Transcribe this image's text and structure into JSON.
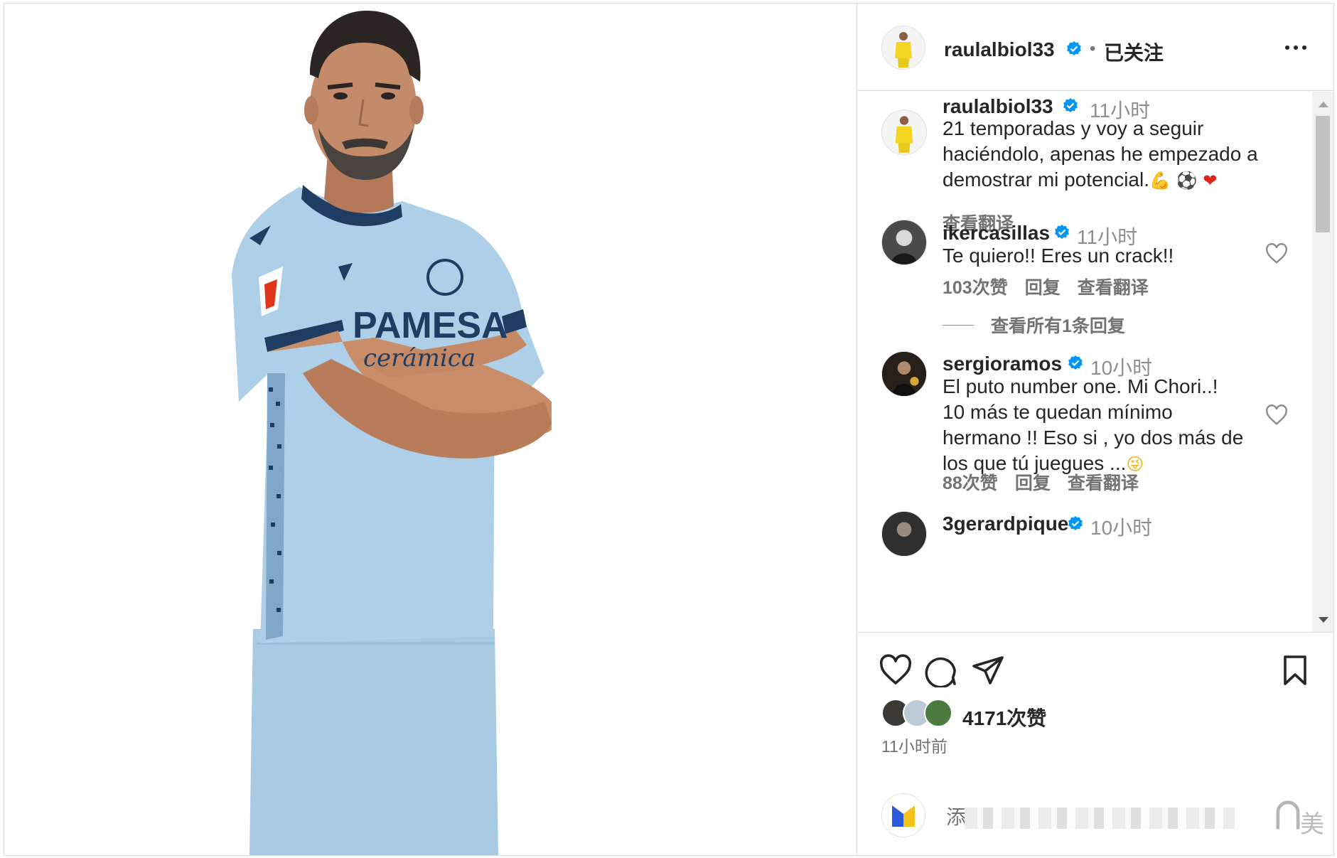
{
  "post": {
    "author": "raulalbiol33",
    "follow_status": "已关注",
    "separator": "•"
  },
  "comments": [
    {
      "user": "raulalbiol33",
      "time": "11小时",
      "text_lines": [
        "21 temporadas y voy a seguir",
        "haciéndolo, apenas he empezado a",
        "demostrar mi potencial."
      ],
      "emojis": [
        "flexed-biceps",
        "soccer-ball",
        "red-heart"
      ],
      "see_translation": "查看翻译"
    },
    {
      "user": "ikercasillas",
      "time": "11小时",
      "text_lines": [
        "Te quiero!! Eres un crack!!"
      ],
      "likes": "103次赞",
      "reply": "回复",
      "see_translation": "查看翻译",
      "view_replies": "查看所有1条回复"
    },
    {
      "user": "sergioramos",
      "time": "10小时",
      "text_lines": [
        "El puto number one. Mi Chori..!",
        "10 más te quedan mínimo",
        "hermano !! Eso si , yo dos más de",
        "los que tú juegues ..."
      ],
      "emojis": [
        "winking-face-with-tongue"
      ],
      "likes": "88次赞",
      "reply": "回复",
      "see_translation": "查看翻译"
    },
    {
      "user": "3gerardpique",
      "time": "10小时"
    }
  ],
  "footer": {
    "likes": "4171次赞",
    "posted": "11小时前",
    "comment_placeholder": "添",
    "badge_char": "美"
  },
  "colors": {
    "verified": "#0095f6",
    "jersey": "#a9cce6",
    "text": "#262626",
    "muted": "#737373"
  }
}
